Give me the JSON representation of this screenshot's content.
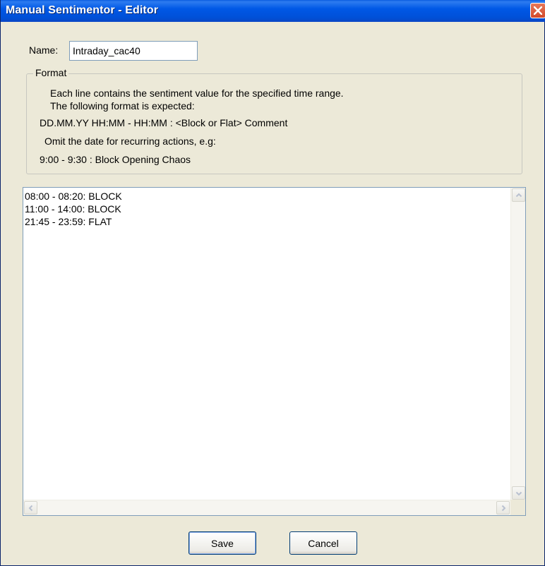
{
  "window": {
    "title": "Manual Sentimentor - Editor",
    "title_bar_color": "#0058e6",
    "close_icon": "close-icon"
  },
  "name_field": {
    "label": "Name:",
    "value": "Intraday_cac40"
  },
  "format_group": {
    "legend": "Format",
    "lines": [
      "Each line contains the sentiment value for the specified time range.",
      "The following format is expected:",
      "DD.MM.YY HH:MM - HH:MM : <Block or Flat> Comment",
      "Omit the date for recurring actions, e.g:",
      "9:00 - 9:30 : Block  Opening Chaos"
    ]
  },
  "editor": {
    "content": "08:00 - 08:20: BLOCK\n11:00 - 14:00: BLOCK\n21:45 - 23:59: FLAT"
  },
  "buttons": {
    "save_label": "Save",
    "cancel_label": "Cancel"
  }
}
